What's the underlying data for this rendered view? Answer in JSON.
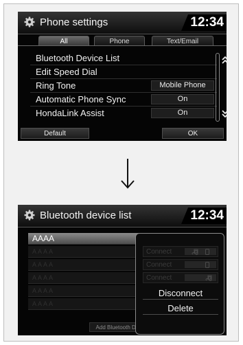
{
  "screen1": {
    "title": "Phone settings",
    "clock": "12:34",
    "tabs": [
      {
        "label": "All",
        "active": true
      },
      {
        "label": "Phone",
        "active": false
      },
      {
        "label": "Text/Email",
        "active": false
      }
    ],
    "rows": [
      {
        "label": "Bluetooth Device List",
        "value": ""
      },
      {
        "label": "Edit Speed Dial",
        "value": ""
      },
      {
        "label": "Ring Tone",
        "value": "Mobile Phone"
      },
      {
        "label": "Automatic Phone Sync",
        "value": "On"
      },
      {
        "label": "HondaLink Assist",
        "value": "On"
      }
    ],
    "buttons": {
      "default": "Default",
      "ok": "OK"
    }
  },
  "screen2": {
    "title": "Bluetooth device list",
    "clock": "12:34",
    "devices": [
      {
        "name": "AAAA",
        "selected": true
      },
      {
        "name": "AAAA",
        "selected": false
      },
      {
        "name": "AAAA",
        "selected": false
      },
      {
        "name": "AAAA",
        "selected": false
      },
      {
        "name": "AAAA",
        "selected": false
      },
      {
        "name": "AAAA",
        "selected": false
      }
    ],
    "popup": {
      "connect_options": [
        {
          "label": "Connect",
          "icons": [
            "music-note-icon",
            "phone-icon"
          ]
        },
        {
          "label": "Connect",
          "icons": [
            "phone-icon"
          ]
        },
        {
          "label": "Connect",
          "icons": [
            "music-note-icon"
          ]
        }
      ],
      "disconnect": "Disconnect",
      "delete": "Delete"
    },
    "add_button": "Add Bluetooth Device"
  },
  "colors": {
    "screen_bg": "#050505",
    "frame_bg": "#f1f1f1",
    "text": "#f2f2f2",
    "dim": "#3c3c3c"
  }
}
